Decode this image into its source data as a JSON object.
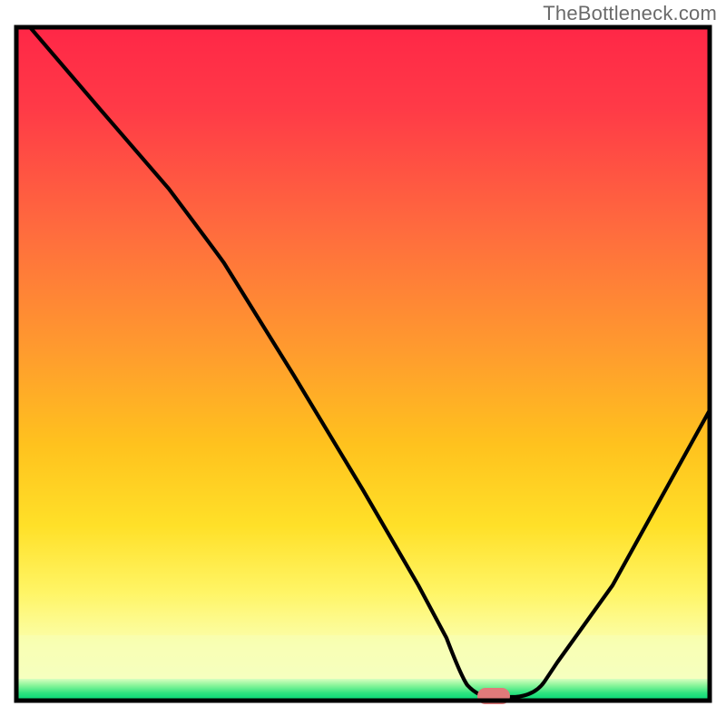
{
  "watermark": "TheBottleneck.com",
  "chart_data": {
    "type": "line",
    "title": "",
    "xlabel": "",
    "ylabel": "",
    "xlim": [
      0,
      100
    ],
    "ylim": [
      0,
      100
    ],
    "grid": false,
    "legend": false,
    "series": [
      {
        "name": "bottleneck-curve",
        "x": [
          2,
          12,
          22,
          30,
          40,
          50,
          58,
          62,
          65,
          68,
          72,
          78,
          86,
          94,
          100
        ],
        "values": [
          100,
          88,
          76,
          66,
          49,
          32,
          18,
          10,
          3,
          0.5,
          0.5,
          3,
          17,
          32,
          43
        ]
      }
    ],
    "marker": {
      "name": "highlight-marker",
      "x": 70,
      "y": 0.5,
      "color": "#e17a7a"
    },
    "background": {
      "top_color": "#ff2848",
      "mid_color": "#ffd400",
      "bottom_band_color": "#00e07a",
      "bottom_fade_color": "#f6ffb8"
    },
    "frame": {
      "stroke": "#000000",
      "stroke_width": 5
    }
  }
}
